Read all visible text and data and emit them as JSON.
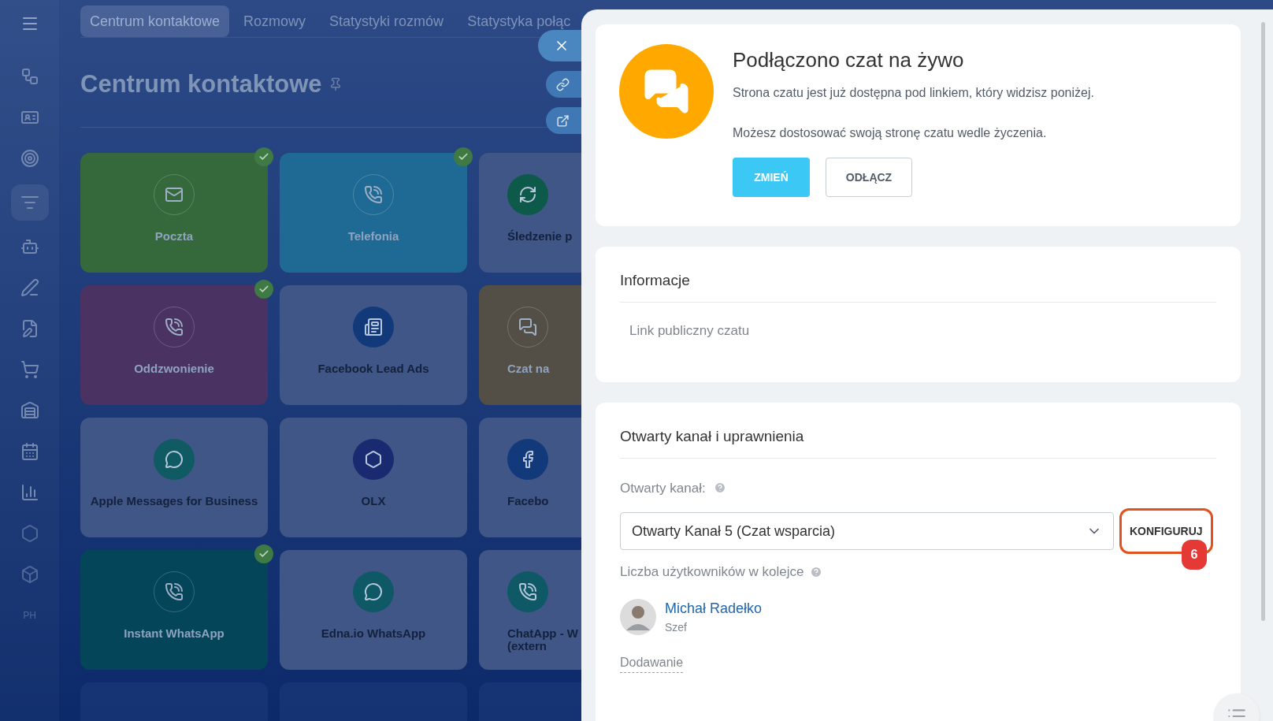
{
  "sidebar": {
    "items": [
      {
        "kind": "icon",
        "selected": false
      },
      {
        "kind": "icon",
        "selected": false
      },
      {
        "kind": "icon",
        "selected": false
      },
      {
        "kind": "icon",
        "selected": true
      },
      {
        "kind": "icon",
        "selected": false
      },
      {
        "kind": "icon",
        "selected": false
      },
      {
        "kind": "icon",
        "selected": false
      },
      {
        "kind": "icon",
        "selected": false
      },
      {
        "kind": "icon",
        "selected": false
      },
      {
        "kind": "icon",
        "selected": false
      },
      {
        "kind": "icon",
        "selected": false
      },
      {
        "kind": "icon",
        "selected": false
      },
      {
        "kind": "icon",
        "selected": false
      },
      {
        "kind": "text",
        "label": "PH",
        "selected": false
      }
    ]
  },
  "tabs": [
    {
      "label": "Centrum kontaktowe",
      "selected": true
    },
    {
      "label": "Rozmowy",
      "selected": false
    },
    {
      "label": "Statystyki rozmów",
      "selected": false
    },
    {
      "label": "Statystyka połąc",
      "selected": false
    }
  ],
  "page_title": "Centrum kontaktowe",
  "tiles": [
    {
      "label": "Poczta",
      "connected": true,
      "color": "#35683a"
    },
    {
      "label": "Telefonia",
      "connected": true,
      "color": "#1f6a94"
    },
    {
      "label": "Śledzenie p",
      "connected": false
    },
    {
      "label": "Oddzwonienie",
      "connected": true,
      "color": "#4a3262"
    },
    {
      "label": "Facebook Lead Ads",
      "connected": false
    },
    {
      "label": "Czat na",
      "connected": true,
      "color": "#534f47"
    },
    {
      "label": "Apple Messages for Business",
      "connected": false
    },
    {
      "label": "OLX",
      "connected": false
    },
    {
      "label": "Facebo",
      "connected": false
    },
    {
      "label": "Instant WhatsApp",
      "connected": true,
      "color": "#04455a"
    },
    {
      "label": "Edna.io WhatsApp",
      "connected": false
    },
    {
      "label": "ChatApp - W\n(extern",
      "connected": false
    }
  ],
  "panel": {
    "hero": {
      "title": "Podłączono czat na żywo",
      "text": "Strona czatu jest już dostępna pod linkiem, który widzisz poniżej.",
      "text2": "Możesz dostosować swoją stronę czatu wedle życzenia.",
      "buttons": [
        {
          "label": "ZMIEŃ",
          "kind": "primary"
        },
        {
          "label": "ODŁĄCZ",
          "kind": "secondary"
        }
      ]
    },
    "info": {
      "title": "Informacje",
      "link_label": "Link publiczny czatu"
    },
    "channel": {
      "title": "Otwarty kanał i uprawnienia",
      "field_label": "Otwarty kanał:",
      "select_value": "Otwarty Kanał 5 (Czat wsparcia)",
      "configure": "KONFIGURUJ",
      "highlighted": true,
      "step_badge": "6",
      "queue_label": "Liczba użytkowników w kolejce",
      "users": [
        {
          "name": "Michał Radełko",
          "role": "Szef"
        }
      ],
      "add": "Dodawanie"
    }
  }
}
